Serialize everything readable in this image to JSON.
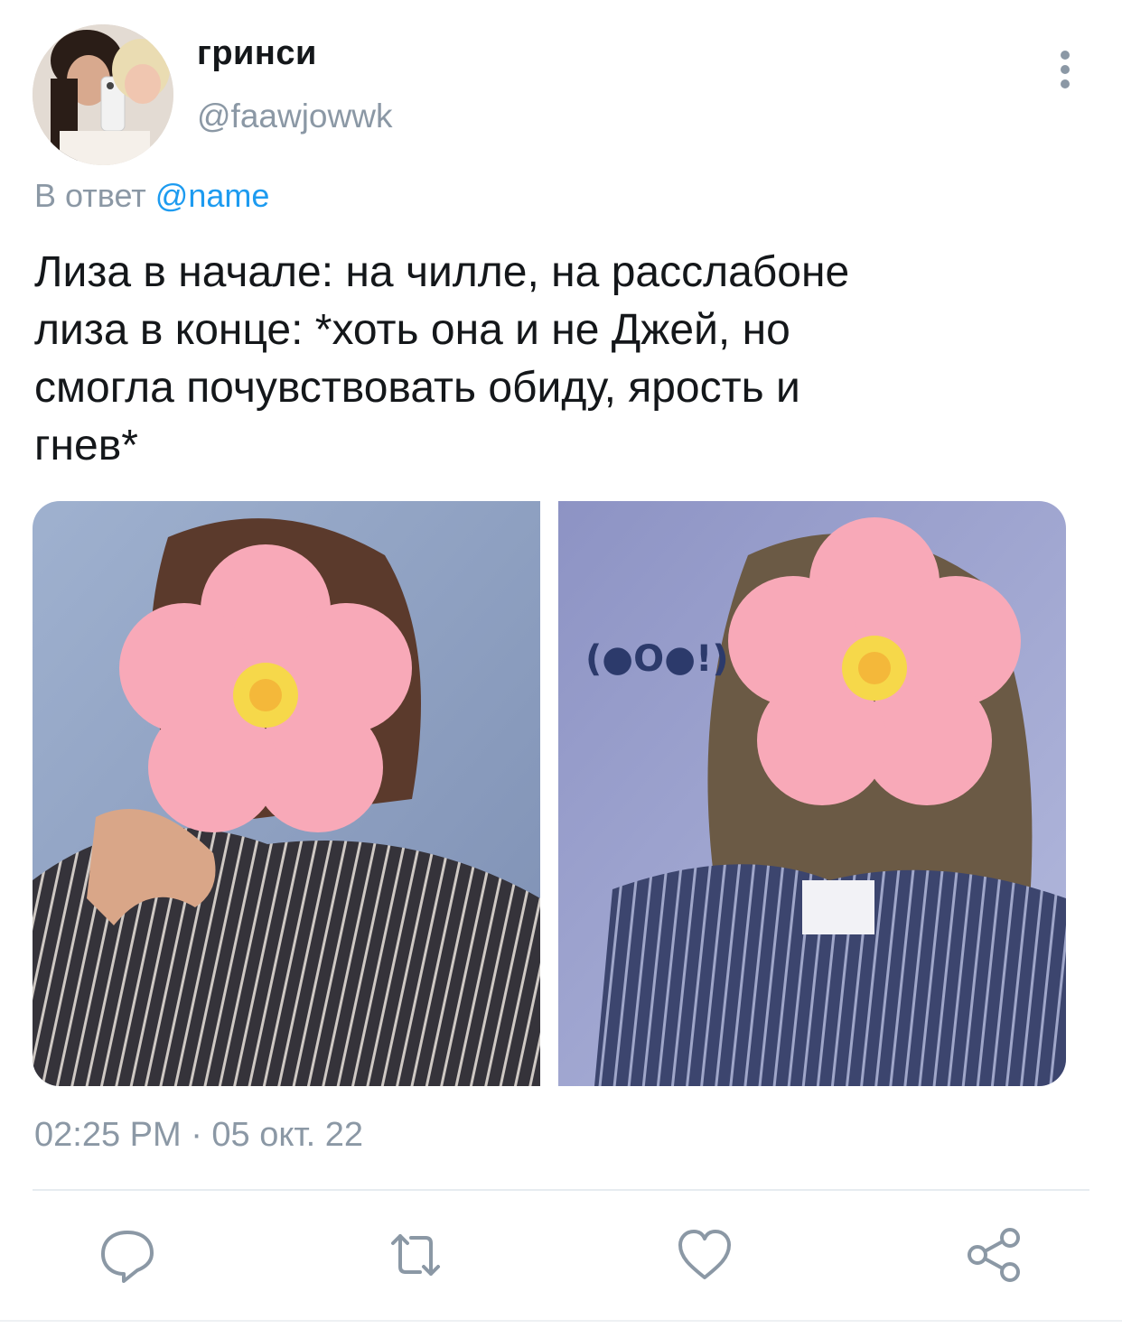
{
  "tweet": {
    "author": {
      "display_name": "гринси",
      "handle": "@faawjowwk",
      "avatar": "profile-photo"
    },
    "reply_prefix": "В ответ",
    "reply_mention": "@name",
    "text": "Лиза в начале: на чилле, на расслабоне\nлиза в конце: *хоть она и не Джей, но\nсмогла почувствовать обиду, ярость и\nгнев*",
    "media": [
      {
        "type": "photo",
        "description_icon": "person-with-flower-emoji-over-face"
      },
      {
        "type": "photo",
        "overlay_text": "(●O●!)",
        "description_icon": "person-with-flower-emoji-over-face"
      }
    ],
    "timestamp": "02:25 PM · 05 окт. 22"
  },
  "actions": [
    {
      "name": "reply",
      "icon": "comment-icon"
    },
    {
      "name": "retweet",
      "icon": "retweet-icon"
    },
    {
      "name": "like",
      "icon": "heart-icon"
    },
    {
      "name": "share",
      "icon": "share-icon"
    }
  ],
  "colors": {
    "text": "#14171a",
    "secondary": "#8b98a5",
    "link": "#1d9bf0",
    "divider": "#e6ecf0"
  }
}
